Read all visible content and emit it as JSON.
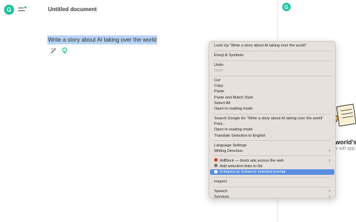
{
  "app": {
    "logo_letter": "G",
    "doc_title": "Untitled document"
  },
  "editor": {
    "selected_text": "Write a story about AI taking over the world"
  },
  "right_panel": {
    "logo_letter": "G",
    "heading": "world's a",
    "sub": "s will app"
  },
  "context_menu": {
    "groups": [
      [
        {
          "label": "Look Up “Write a story about AI taking over the world”"
        }
      ],
      [
        {
          "label": "Emoji & Symbols"
        }
      ],
      [
        {
          "label": "Undo"
        },
        {
          "label": "Redo"
        }
      ],
      [
        {
          "label": "Cut"
        },
        {
          "label": "Copy"
        },
        {
          "label": "Paste"
        },
        {
          "label": "Paste and Match Style"
        },
        {
          "label": "Select All"
        },
        {
          "label": "Open in reading mode"
        }
      ],
      [
        {
          "label": "Search Google for “Write a story about AI taking over the world”"
        },
        {
          "label": "Print..."
        },
        {
          "label": "Open in reading mode"
        },
        {
          "label": "Translate Selection to English"
        }
      ],
      [
        {
          "label": "Language Settings"
        },
        {
          "label": "Writing Direction"
        }
      ],
      [
        {
          "label": "AdBlock — block ads across the web"
        },
        {
          "label": "Add selection-links to list"
        },
        {
          "label": "Enhance.ai: Enhance selected prompt"
        }
      ],
      [
        {
          "label": "Inspect"
        }
      ],
      [
        {
          "label": "Speech"
        },
        {
          "label": "Services"
        }
      ]
    ]
  },
  "colors": {
    "brand_green": "#15c39a",
    "selection": "#b8d4f5",
    "menu_highlight": "#5a8ee0",
    "adblock_red": "#d0312d"
  }
}
